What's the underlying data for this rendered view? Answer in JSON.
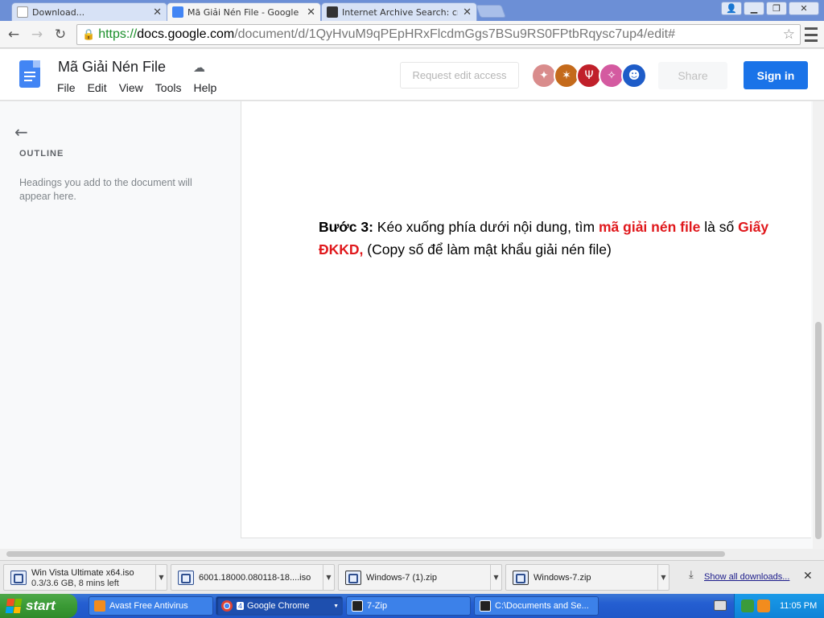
{
  "browser": {
    "tabs": [
      {
        "label": "Download...",
        "icon": "page-icon",
        "active": false
      },
      {
        "label": "Mã Giải Nén File - Google Doc",
        "icon": "google-docs-icon",
        "active": true
      },
      {
        "label": "Internet Archive Search: cre",
        "icon": "archive-icon",
        "active": false
      }
    ],
    "url": {
      "scheme": "https://",
      "host": "docs.google.com",
      "path": "/document/d/1QyHvuM9qPEpHRxFlcdmGgs7BSu9RS0FPtbRqysc7up4/edit#"
    }
  },
  "docs": {
    "title": "Mã Giải Nén File",
    "menu": [
      "File",
      "Edit",
      "View",
      "Tools",
      "Help"
    ],
    "request_edit_label": "Request edit access",
    "share_label": "Share",
    "signin_label": "Sign in",
    "avatars": [
      {
        "icon": "animal-avatar-icon",
        "color": "#d98c8c"
      },
      {
        "icon": "hedgehog-avatar-icon",
        "color": "#c46a1b"
      },
      {
        "icon": "ibex-avatar-icon",
        "color": "#c0202a"
      },
      {
        "icon": "animal-avatar-icon",
        "color": "#d45aa0"
      },
      {
        "icon": "animal-avatar-icon",
        "color": "#1e5cc8"
      }
    ],
    "outline": {
      "title": "OUTLINE",
      "hint": "Headings you add to the document will appear here."
    },
    "content": {
      "step_label": "Bước 3:",
      "text_1": "Kéo xuống phía dưới nội dung, tìm",
      "highlight_1": "mã giải nén file",
      "text_2": "là số",
      "highlight_2": "Giấy",
      "highlight_3": "ĐKKD,",
      "text_3": "(Copy số để làm mật khẩu giải nén file)"
    }
  },
  "downloads": {
    "items": [
      {
        "name": "Win Vista Ultimate x64.iso",
        "status": "0.3/3.6 GB, 8 mins left",
        "icon": "iso-icon"
      },
      {
        "name": "6001.18000.080118-18....iso",
        "status": "",
        "icon": "iso-icon"
      },
      {
        "name": "Windows-7 (1).zip",
        "status": "",
        "icon": "7zip-icon"
      },
      {
        "name": "Windows-7.zip",
        "status": "",
        "icon": "7zip-icon"
      }
    ],
    "show_all_label": "Show all downloads..."
  },
  "taskbar": {
    "start_label": "start",
    "items": [
      {
        "label": "Avast Free Antivirus",
        "icon": "avast-icon",
        "count": ""
      },
      {
        "label": "Google Chrome",
        "icon": "chrome-icon",
        "count": "4"
      },
      {
        "label": "7-Zip",
        "icon": "7zip-icon",
        "count": ""
      },
      {
        "label": "C:\\Documents and Se...",
        "icon": "folder-icon",
        "count": ""
      }
    ],
    "clock": "11:05 PM"
  }
}
